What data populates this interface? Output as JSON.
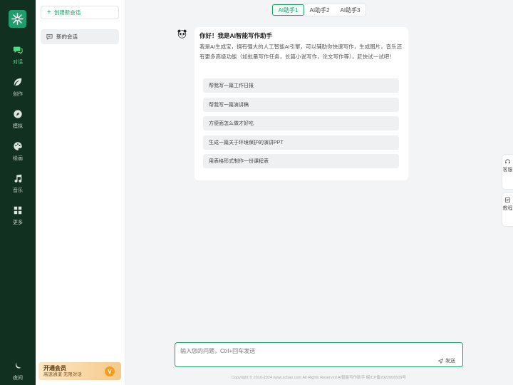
{
  "sidebar": {
    "items": [
      {
        "label": "对话",
        "icon": "chat-icon"
      },
      {
        "label": "创作",
        "icon": "leaf-icon"
      },
      {
        "label": "模拟",
        "icon": "compass-icon"
      },
      {
        "label": "绘画",
        "icon": "palette-icon"
      },
      {
        "label": "音乐",
        "icon": "music-icon"
      },
      {
        "label": "更多",
        "icon": "grid-icon"
      }
    ],
    "night": {
      "label": "夜间",
      "icon": "moon-icon"
    }
  },
  "panel": {
    "new_chat_label": "创建新会话",
    "chats": [
      {
        "label": "新的会话"
      }
    ],
    "vip": {
      "title": "开通会员",
      "subtitle": "高速通道 无限对话",
      "badge": "V"
    }
  },
  "tabs": [
    {
      "label": "AI助手1",
      "active": true
    },
    {
      "label": "AI助手2",
      "active": false
    },
    {
      "label": "AI助手3",
      "active": false
    }
  ],
  "message": {
    "greeting": "你好！我是AI智能写作助手",
    "intro": "我是AI生成宝，拥有强大的人工智能AI引擎，可以辅助你快速写作，生成图片，音乐还有更多高级功能（如批量写作任务，长篇小说写作，论文写作等），赶快试一试吧！",
    "suggestions": [
      "帮我写一篇工作日报",
      "帮我写一篇演讲稿",
      "方便面怎么做才好吃",
      "生成一篇关于环境保护的演讲PPT",
      "用表格形式制作一份课程表"
    ]
  },
  "float": [
    {
      "label": "客服",
      "icon": "headset-icon"
    },
    {
      "label": "教程",
      "icon": "book-icon"
    }
  ],
  "input": {
    "placeholder": "输入您的问题，Ctrl+回车发送",
    "value": "",
    "send_label": "发送"
  },
  "footer": {
    "text": "Copyright © 2016-2024 www.scbao.com All Rights Reserved AI智能写作助手   皖ICP备2022006509号"
  },
  "colors": {
    "accent": "#1f9d6b",
    "rail": "#12301f",
    "vip": "#f6c98b"
  }
}
